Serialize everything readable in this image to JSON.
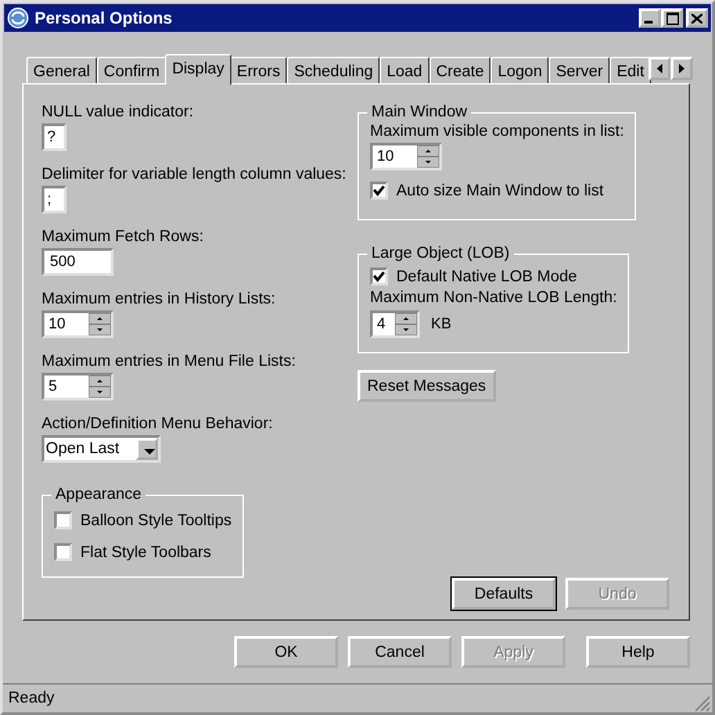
{
  "window": {
    "title": "Personal Options"
  },
  "tabs": [
    {
      "label": "General",
      "selected": false
    },
    {
      "label": "Confirm",
      "selected": false
    },
    {
      "label": "Display",
      "selected": true
    },
    {
      "label": "Errors",
      "selected": false
    },
    {
      "label": "Scheduling",
      "selected": false
    },
    {
      "label": "Load",
      "selected": false
    },
    {
      "label": "Create",
      "selected": false
    },
    {
      "label": "Logon",
      "selected": false
    },
    {
      "label": "Server",
      "selected": false
    },
    {
      "label": "Edit",
      "selected": false
    }
  ],
  "fields": [
    {
      "kind": "char",
      "label": "NULL value indicator:",
      "value": "?"
    },
    {
      "kind": "char",
      "label": "Delimiter for variable length column values:",
      "value": ";"
    },
    {
      "kind": "text",
      "label": "Maximum Fetch Rows:",
      "value": "500"
    },
    {
      "kind": "spin",
      "label": "Maximum entries in History Lists:",
      "value": "10"
    },
    {
      "kind": "spin",
      "label": "Maximum entries in Menu File Lists:",
      "value": "5"
    },
    {
      "kind": "dropdown",
      "label": "Action/Definition Menu Behavior:",
      "value": "Open Last"
    }
  ],
  "appearance": {
    "title": "Appearance",
    "options": [
      {
        "label": "Balloon Style Tooltips",
        "checked": false
      },
      {
        "label": "Flat Style Toolbars",
        "checked": false
      }
    ]
  },
  "main_window": {
    "title": "Main Window",
    "label": "Maximum visible components in list:",
    "value": "10",
    "option": {
      "label": "Auto size Main Window to list",
      "checked": true
    }
  },
  "lob": {
    "title": "Large Object (LOB)",
    "option": {
      "label": "Default Native LOB Mode",
      "checked": true
    },
    "label": "Maximum Non-Native LOB Length:",
    "value": "4",
    "unit": "KB"
  },
  "reset_button": "Reset Messages",
  "panel_buttons": [
    {
      "label": "Defaults",
      "default": true,
      "disabled": false
    },
    {
      "label": "Undo",
      "default": false,
      "disabled": true
    }
  ],
  "dialog_buttons": [
    {
      "label": "OK",
      "disabled": false
    },
    {
      "label": "Cancel",
      "disabled": false
    },
    {
      "label": "Apply",
      "disabled": true
    },
    {
      "label": "Help",
      "disabled": false
    }
  ],
  "status_bar": "Ready"
}
